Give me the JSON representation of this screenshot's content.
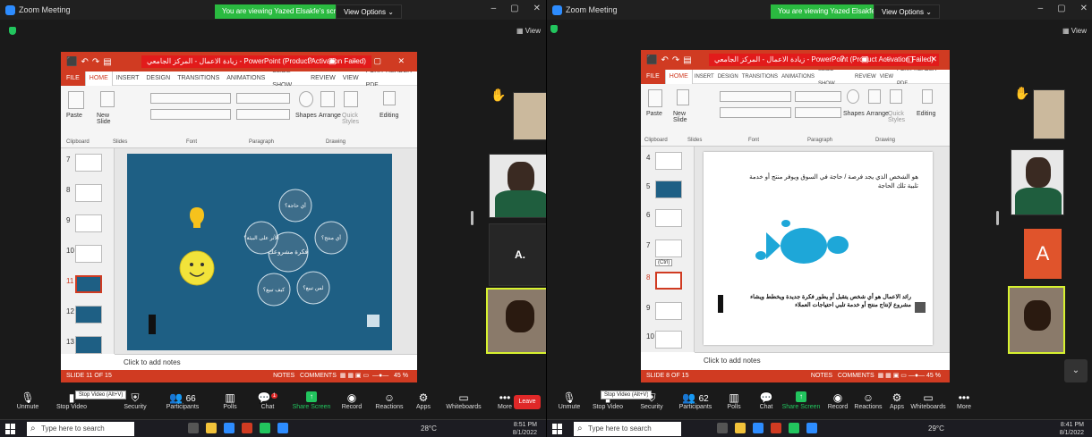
{
  "app_name": "Zoom Meeting",
  "share_banner": "You are viewing Yazed Elsakfe's screen",
  "view_options": "View Options ⌄",
  "view_label": "View",
  "powerpoint": {
    "title": "زيادة الاعمال - المركز الجامعي - PowerPoint (Product Activation Failed)",
    "tabs": [
      "FILE",
      "HOME",
      "INSERT",
      "DESIGN",
      "TRANSITIONS",
      "ANIMATIONS",
      "SLIDE SHOW",
      "REVIEW",
      "VIEW",
      "FOXIT READER PDF"
    ],
    "ribbon": {
      "paste": "Paste",
      "new_slide": "New Slide",
      "shapes": "Shapes",
      "arrange": "Arrange",
      "quick_styles": "Quick Styles",
      "editing": "Editing",
      "groups": [
        "Clipboard",
        "Slides",
        "Font",
        "Paragraph",
        "Drawing"
      ]
    },
    "notes_placeholder": "Click to add notes",
    "notes_btn": "NOTES",
    "comments_btn": "COMMENTS",
    "zoom_pct": "45 %"
  },
  "window1": {
    "thumb_numbers": [
      "7",
      "8",
      "9",
      "10",
      "11",
      "12",
      "13"
    ],
    "slide_status": "SLIDE 11 OF 15",
    "bubbles": [
      "أي حاجة؟",
      "أي منتج؟",
      "لمن تبيع؟",
      "كيف تبيع؟",
      "الأثر على البيئة؟"
    ],
    "center_bubble": "فكرة مشروعك",
    "participant_name": "A.",
    "clock_time": "8:51 PM",
    "clock_date": "8/1/2022"
  },
  "window2": {
    "thumb_numbers": [
      "4",
      "5",
      "6",
      "7",
      "8",
      "9",
      "10"
    ],
    "slide_status": "SLIDE 8 OF 15",
    "slide_text_top": "هو الشخص الذي يجد فرصة / حاجة في السوق ويوفر منتج أو خدمة تلبية تلك الحاجة",
    "slide_text_bottom": "رائد الاعمال هو أي شخص يتقبل أو يطور فكرة جديدة ويخطط ويشاء مشروع لإنتاج منتج أو خدمة تلبي احتياجات العملاء",
    "ctrl_popup": "(Ctrl)",
    "avatar_letter": "A",
    "clock_time": "8:41 PM",
    "clock_date": "8/1/2022"
  },
  "toolbar": {
    "unmute": "Unmute",
    "stop_video": "Stop Video",
    "security": "Security",
    "participants": "Participants",
    "participants_count_1": "66",
    "participants_count_2": "62",
    "polls": "Polls",
    "chat": "Chat",
    "share_screen": "Share Screen",
    "record": "Record",
    "reactions": "Reactions",
    "apps": "Apps",
    "whiteboards": "Whiteboards",
    "more": "More",
    "leave": "Leave",
    "stop_video_tooltip": "Stop Video (Alt+V)",
    "chat_badge": "1"
  },
  "taskbar": {
    "search_placeholder": "Type here to search",
    "temp": "28°C",
    "temp2": "29°C"
  },
  "colors": {
    "zoom_bg": "#1a1a1a",
    "share_green": "#2aba40",
    "ppt_red": "#d03b22",
    "active_speaker": "#d7f22f",
    "leave_red": "#e02828",
    "slide_blue": "#1e5f84"
  }
}
